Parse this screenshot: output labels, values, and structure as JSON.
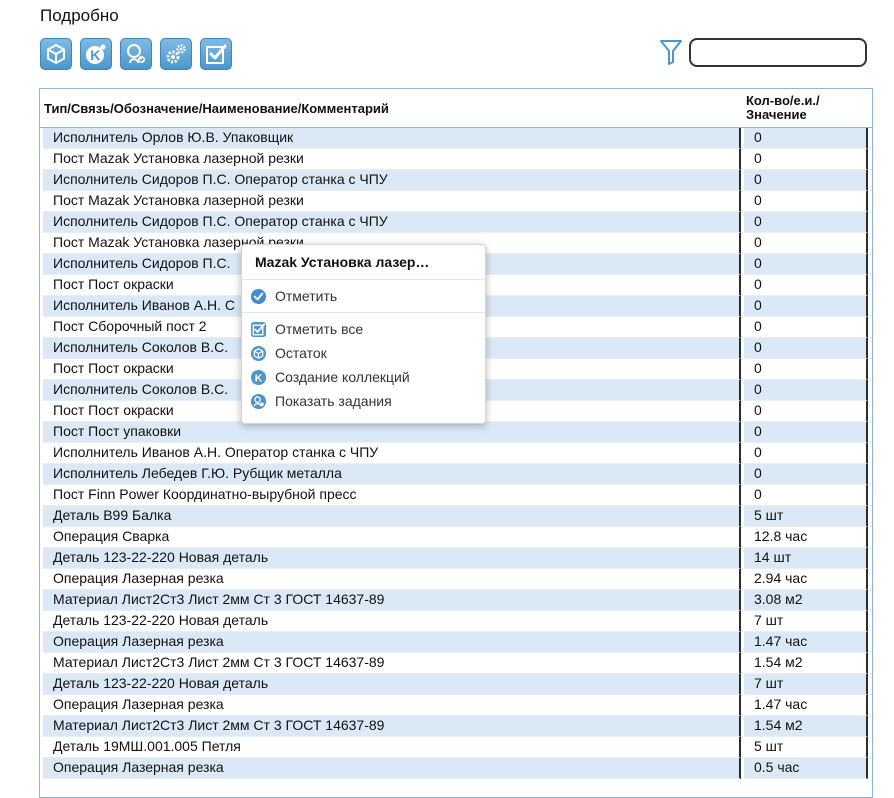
{
  "page": {
    "title": "Подробно"
  },
  "toolbar": {
    "buttons": [
      {
        "icon": "box-icon"
      },
      {
        "icon": "collection-k-icon"
      },
      {
        "icon": "user-search-icon"
      },
      {
        "icon": "gears-icon"
      },
      {
        "icon": "checkbox-icon"
      }
    ],
    "filter_icon": "filter-icon",
    "search_value": ""
  },
  "grid": {
    "columns": [
      "Тип/Связь/Обозначение/Наименование/Комментарий",
      "Кол-во/е.и./\nЗначение"
    ],
    "rows": [
      [
        "Исполнитель Орлов Ю.В. Упаковщик",
        "0"
      ],
      [
        "Пост Mazak Установка лазерной резки",
        "0"
      ],
      [
        "Исполнитель Сидоров П.С. Оператор станка с ЧПУ",
        "0"
      ],
      [
        "Пост Mazak Установка лазерной резки",
        "0"
      ],
      [
        "Исполнитель Сидоров П.С. Оператор станка с ЧПУ",
        "0"
      ],
      [
        "Пост Mazak Установка лазерной резки",
        "0"
      ],
      [
        "Исполнитель Сидоров П.С.",
        "0"
      ],
      [
        "Пост Пост окраски",
        "0"
      ],
      [
        "Исполнитель Иванов А.Н. С",
        "0"
      ],
      [
        "Пост Сборочный пост 2",
        "0"
      ],
      [
        "Исполнитель Соколов В.С.",
        "0"
      ],
      [
        "Пост Пост окраски",
        "0"
      ],
      [
        "Исполнитель Соколов В.С.",
        "0"
      ],
      [
        "Пост Пост окраски",
        "0"
      ],
      [
        "Пост Пост упаковки",
        "0"
      ],
      [
        "Исполнитель Иванов А.Н. Оператор станка с ЧПУ",
        "0"
      ],
      [
        "Исполнитель Лебедев Г.Ю. Рубщик металла",
        "0"
      ],
      [
        "Пост Finn Power Координатно-вырубной пресс",
        "0"
      ],
      [
        "Деталь В99 Балка",
        "5 шт"
      ],
      [
        "Операция Сварка",
        "12.8 час"
      ],
      [
        "Деталь 123-22-220 Новая деталь",
        "14 шт"
      ],
      [
        "Операция Лазерная резка",
        "2.94 час"
      ],
      [
        "Материал Лист2Ст3 Лист 2мм Ст 3 ГОСТ 14637-89",
        "3.08 м2"
      ],
      [
        "Деталь 123-22-220 Новая деталь",
        "7 шт"
      ],
      [
        "Операция Лазерная резка",
        "1.47 час"
      ],
      [
        "Материал Лист2Ст3 Лист 2мм Ст 3 ГОСТ 14637-89",
        "1.54 м2"
      ],
      [
        "Деталь 123-22-220 Новая деталь",
        "7 шт"
      ],
      [
        "Операция Лазерная резка",
        "1.47 час"
      ],
      [
        "Материал Лист2Ст3 Лист 2мм Ст 3 ГОСТ 14637-89",
        "1.54 м2"
      ],
      [
        "Деталь 19МШ.001.005 Петля",
        "5 шт"
      ],
      [
        "Операция Лазерная резка",
        "0.5 час"
      ]
    ]
  },
  "context_menu": {
    "title": "Mazak Установка лазер…",
    "items": [
      {
        "label": "Отметить",
        "icon": "check-circle-icon"
      },
      {
        "label": "Отметить все",
        "icon": "checkbox-icon"
      },
      {
        "label": "Остаток",
        "icon": "box-icon"
      },
      {
        "label": "Создание коллекций",
        "icon": "collection-k-icon"
      },
      {
        "label": "Показать задания",
        "icon": "user-search-icon"
      }
    ]
  },
  "colors": {
    "accent": "#4e96c9",
    "row_alt": "#dbe9f6",
    "border": "#8fb6d8"
  }
}
